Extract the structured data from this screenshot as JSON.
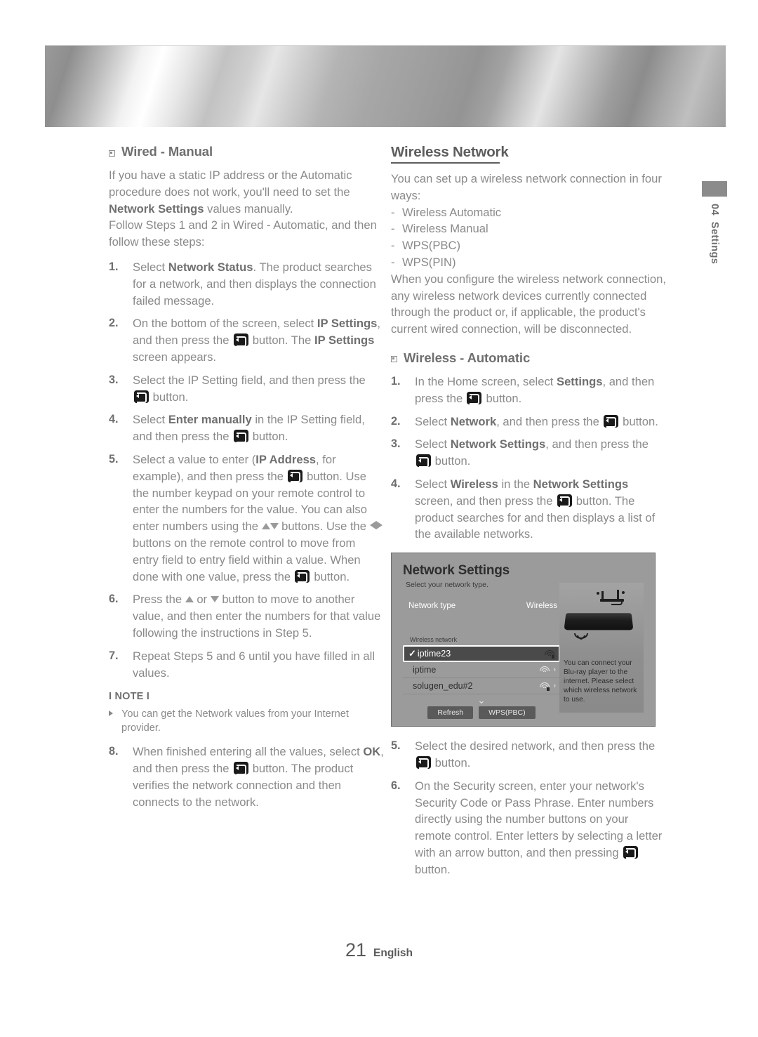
{
  "banner": {
    "name": "decorative-metallic-banner"
  },
  "side_tab": {
    "number": "04",
    "label": "Settings"
  },
  "left_column": {
    "heading": "Wired - Manual",
    "intro": [
      "If you have a static IP address or the Automatic procedure does not work, you'll need to set the ",
      "Network Settings",
      " values manually."
    ],
    "intro2": "Follow Steps 1 and 2 in Wired - Automatic, and then follow these steps:",
    "steps": [
      {
        "num": "1.",
        "text": "Select Network Status. The product searches for a network, and then displays the connection failed message."
      },
      {
        "num": "2.",
        "text": "On the bottom of the screen, select IP Settings, and then press the [enter] button. The IP Settings screen appears."
      },
      {
        "num": "3.",
        "text": "Select the IP Setting field, and then press the [enter] button."
      },
      {
        "num": "4.",
        "text": "Select Enter manually in the IP Setting field, and then press the [enter] button."
      },
      {
        "num": "5.",
        "text": "Select a value to enter (IP Address, for example), and then press the [enter] button. Use the number keypad on your remote control to enter the numbers for the value. You can also enter numbers using the [up][down] buttons. Use the [left][right] buttons on the remote control to move from entry field to entry field within a value. When done with one value, press the [enter] button."
      },
      {
        "num": "6.",
        "text": "Press the [up] or [down] button to move to another value, and then enter the numbers for that value following the instructions in Step 5."
      },
      {
        "num": "7.",
        "text": "Repeat Steps 5 and 6 until you have filled in all values."
      },
      {
        "num": "8.",
        "text": "When finished entering all the values, select OK, and then press the [enter] button. The product verifies the network connection and then connects to the network."
      }
    ],
    "note_title": "I NOTE I",
    "note_items": [
      "You can get the Network values from your Internet provider."
    ]
  },
  "right_column": {
    "section_heading": "Wireless Network",
    "intro": "You can set up a wireless network connection in four ways:",
    "ways": [
      "Wireless Automatic",
      "Wireless Manual",
      "WPS(PBC)",
      "WPS(PIN)"
    ],
    "paragraph": "When you configure the wireless network connection, any wireless network devices currently connected through the product or, if applicable, the product's current wired connection, will be disconnected.",
    "sub_heading": "Wireless - Automatic",
    "steps_before": [
      {
        "num": "1.",
        "text": "In the Home screen, select Settings, and then press the [enter] button."
      },
      {
        "num": "2.",
        "text": "Select Network, and then press the [enter] button."
      },
      {
        "num": "3.",
        "text": "Select Network Settings, and then press the [enter] button."
      },
      {
        "num": "4.",
        "text": "Select Wireless in the Network Settings screen, and then press the [enter] button. The product searches for and then displays a list of the available networks."
      }
    ],
    "steps_after": [
      {
        "num": "5.",
        "text": "Select the desired network, and then press the [enter] button."
      },
      {
        "num": "6.",
        "text": "On the Security screen, enter your network's Security Code or Pass Phrase. Enter numbers directly using the number buttons on your remote control. Enter letters by selecting a letter with an arrow button, and then pressing [enter] button."
      }
    ]
  },
  "tv_screenshot": {
    "title": "Network Settings",
    "subtitle": "Select your network type.",
    "row_label": "Network type",
    "row_value": "Wireless",
    "list_label": "Wireless network",
    "networks": [
      {
        "name": "iptime23",
        "selected": true,
        "secured": true
      },
      {
        "name": "iptime",
        "selected": false,
        "secured": false
      },
      {
        "name": "solugen_edu#2",
        "selected": false,
        "secured": true
      }
    ],
    "buttons": [
      "Refresh",
      "WPS(PBC)"
    ],
    "panel_text": "You can connect your Blu-ray player to the internet. Please select which wireless network to use."
  },
  "footer": {
    "page_number": "21",
    "language": "English"
  }
}
